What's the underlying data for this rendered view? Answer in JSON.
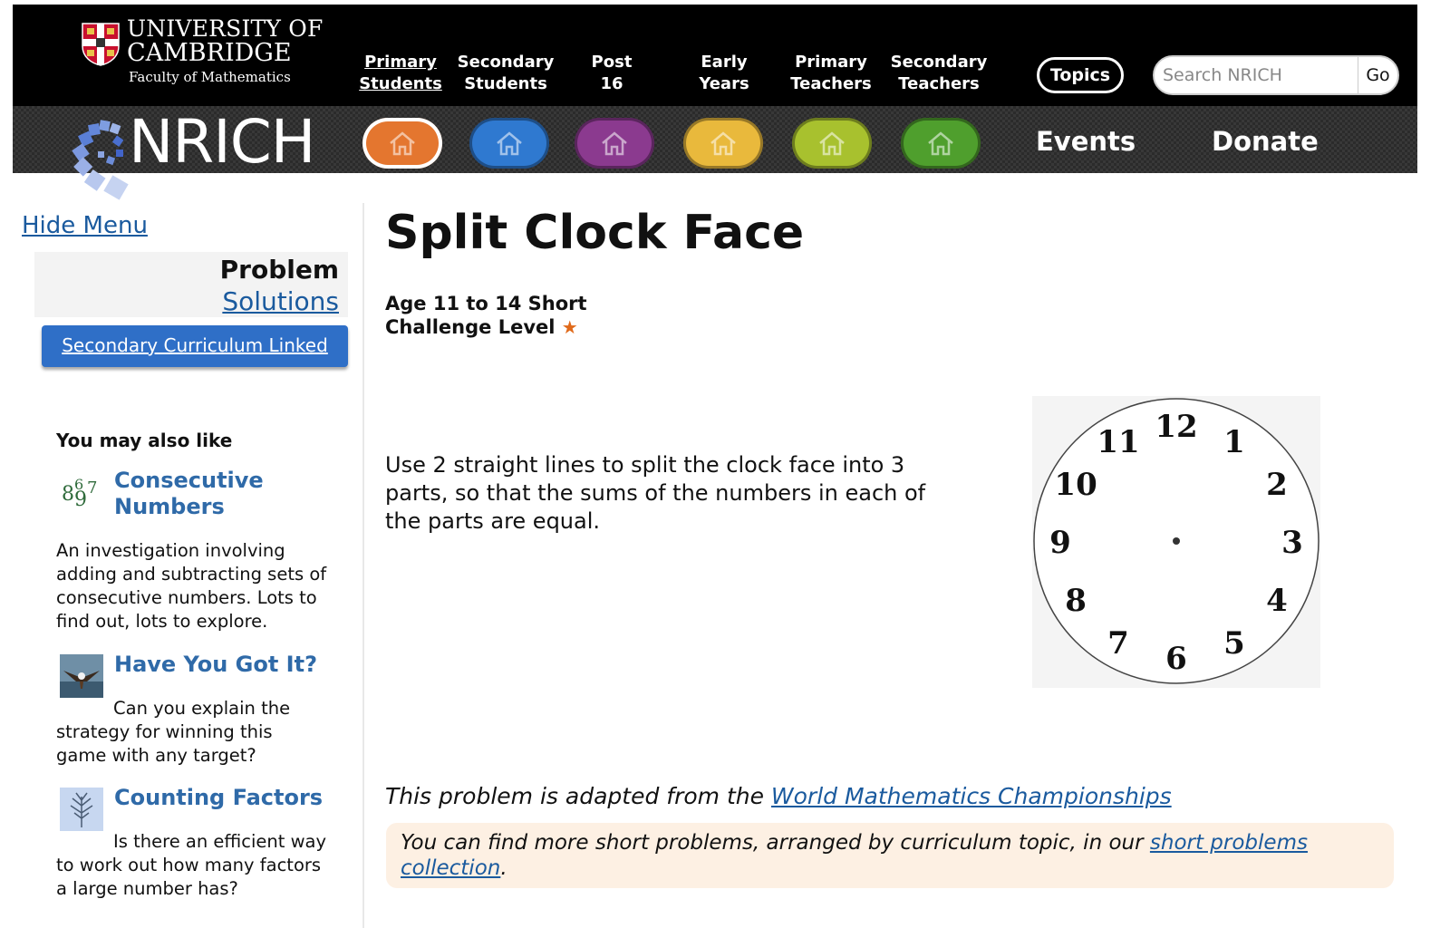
{
  "header": {
    "university_line1": "UNIVERSITY OF",
    "university_line2": "CAMBRIDGE",
    "faculty": "Faculty of Mathematics",
    "nav": [
      {
        "line1": "Primary",
        "line2": "Students"
      },
      {
        "line1": "Secondary",
        "line2": "Students"
      },
      {
        "line1": "Post",
        "line2": "16"
      },
      {
        "line1": "Early",
        "line2": "Years"
      },
      {
        "line1": "Primary",
        "line2": "Teachers"
      },
      {
        "line1": "Secondary",
        "line2": "Teachers"
      }
    ],
    "topics_label": "Topics",
    "search_placeholder": "Search NRICH",
    "go_label": "Go",
    "brand": "NRICH",
    "events_label": "Events",
    "donate_label": "Donate",
    "house_colors": [
      "#e4762f",
      "#2f79d0",
      "#8b3a8f",
      "#e9b93c",
      "#a8c12e",
      "#4f9f2d"
    ]
  },
  "sidebar": {
    "hide_menu": "Hide Menu",
    "problem_label": "Problem",
    "solutions_label": "Solutions",
    "curriculum_button": "Secondary Curriculum Linked",
    "also_like_title": "You may also like",
    "items": [
      {
        "title": "Consecutive Numbers",
        "description": "An investigation involving adding and subtracting sets of consecutive numbers. Lots to find out, lots to explore."
      },
      {
        "title": "Have You Got It?",
        "description": "Can you explain the strategy for winning this game with any target?"
      },
      {
        "title": "Counting Factors",
        "description": "Is there an efficient way to work out how many factors a large number has?"
      }
    ]
  },
  "main": {
    "title": "Split Clock Face",
    "age_line": "Age 11 to 14 Short",
    "challenge_line": "Challenge Level",
    "star": "★",
    "problem_text": "Use 2 straight lines to split the clock face into 3 parts, so that the sums of the numbers in each of the parts are equal.",
    "clock_numbers": [
      "12",
      "1",
      "2",
      "3",
      "4",
      "5",
      "6",
      "7",
      "8",
      "9",
      "10",
      "11"
    ],
    "credit_prefix": "This problem is adapted from the ",
    "credit_link": "World Mathematics Championships",
    "notice_prefix": "You can find more short problems, arranged by curriculum topic, in our ",
    "notice_link": "short problems collection",
    "notice_suffix": "."
  }
}
